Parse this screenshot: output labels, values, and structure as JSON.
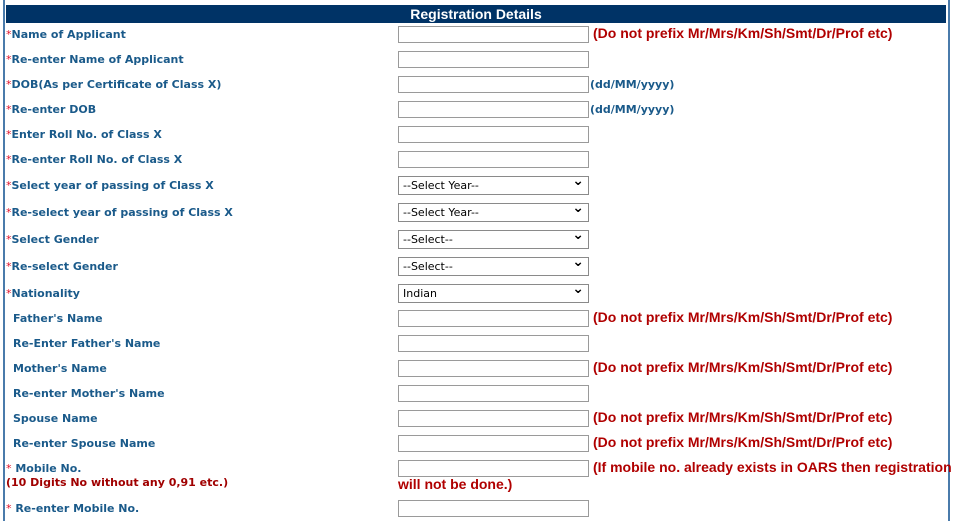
{
  "header": {
    "title": "Registration Details"
  },
  "colors": {
    "header_bg": "#003366",
    "label": "#1a5a8a",
    "hint": "#b00000",
    "required": "#e0102a"
  },
  "rows": [
    {
      "label": "Name of Applicant",
      "required": true,
      "type": "text",
      "value": "",
      "hint": "(Do not prefix Mr/Mrs/Km/Sh/Smt/Dr/Prof etc)"
    },
    {
      "label": "Re-enter Name of Applicant",
      "required": true,
      "type": "text",
      "value": ""
    },
    {
      "label": "DOB(As per Certificate of Class X)",
      "required": true,
      "type": "text",
      "value": "",
      "format": "(dd/MM/yyyy)"
    },
    {
      "label": "Re-enter DOB",
      "required": true,
      "type": "text",
      "value": "",
      "format": "(dd/MM/yyyy)"
    },
    {
      "label": "Enter Roll No. of Class X",
      "required": true,
      "type": "text",
      "value": ""
    },
    {
      "label": "Re-enter Roll No. of Class X",
      "required": true,
      "type": "text",
      "value": ""
    },
    {
      "label": "Select year of passing of Class X",
      "required": true,
      "type": "select",
      "value": "--Select Year--"
    },
    {
      "label": "Re-select year of passing of Class X",
      "required": true,
      "type": "select",
      "value": "--Select Year--"
    },
    {
      "label": "Select Gender",
      "required": true,
      "type": "select",
      "value": "--Select--"
    },
    {
      "label": "Re-select Gender",
      "required": true,
      "type": "select",
      "value": "--Select--"
    },
    {
      "label": "Nationality",
      "required": true,
      "type": "select",
      "value": "Indian"
    },
    {
      "label": "Father's Name",
      "required": false,
      "type": "text",
      "value": "",
      "hint": "(Do not prefix Mr/Mrs/Km/Sh/Smt/Dr/Prof etc)"
    },
    {
      "label": "Re-Enter Father's Name",
      "required": false,
      "type": "text",
      "value": ""
    },
    {
      "label": "Mother's Name",
      "required": false,
      "type": "text",
      "value": "",
      "hint": "(Do not prefix Mr/Mrs/Km/Sh/Smt/Dr/Prof etc)"
    },
    {
      "label": "Re-enter Mother's Name",
      "required": false,
      "type": "text",
      "value": ""
    },
    {
      "label": "Spouse Name",
      "required": false,
      "type": "text",
      "value": "",
      "hint": "(Do not prefix Mr/Mrs/Km/Sh/Smt/Dr/Prof etc)"
    },
    {
      "label": "Re-enter Spouse Name",
      "required": false,
      "type": "text",
      "value": "",
      "hint": "(Do not prefix Mr/Mrs/Km/Sh/Smt/Dr/Prof etc)"
    },
    {
      "label": " Mobile No.",
      "required": true,
      "type": "text",
      "value": "",
      "sublabel": "(10 Digits No without any 0,91 etc.)",
      "hint": "(If mobile no. already exists in OARS then registration",
      "hint_cont": "will not be done.)"
    },
    {
      "label": " Re-enter Mobile No.",
      "required": true,
      "type": "text",
      "value": ""
    }
  ]
}
